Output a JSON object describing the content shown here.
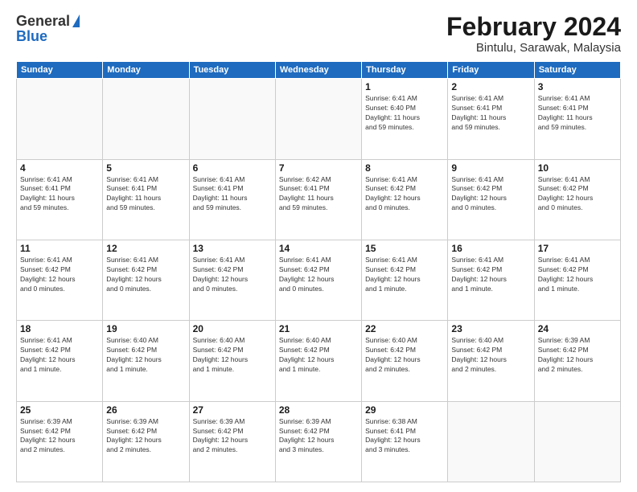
{
  "logo": {
    "general": "General",
    "blue": "Blue"
  },
  "title": {
    "month_year": "February 2024",
    "location": "Bintulu, Sarawak, Malaysia"
  },
  "weekdays": [
    "Sunday",
    "Monday",
    "Tuesday",
    "Wednesday",
    "Thursday",
    "Friday",
    "Saturday"
  ],
  "weeks": [
    [
      {
        "day": "",
        "info": ""
      },
      {
        "day": "",
        "info": ""
      },
      {
        "day": "",
        "info": ""
      },
      {
        "day": "",
        "info": ""
      },
      {
        "day": "1",
        "info": "Sunrise: 6:41 AM\nSunset: 6:40 PM\nDaylight: 11 hours\nand 59 minutes."
      },
      {
        "day": "2",
        "info": "Sunrise: 6:41 AM\nSunset: 6:41 PM\nDaylight: 11 hours\nand 59 minutes."
      },
      {
        "day": "3",
        "info": "Sunrise: 6:41 AM\nSunset: 6:41 PM\nDaylight: 11 hours\nand 59 minutes."
      }
    ],
    [
      {
        "day": "4",
        "info": "Sunrise: 6:41 AM\nSunset: 6:41 PM\nDaylight: 11 hours\nand 59 minutes."
      },
      {
        "day": "5",
        "info": "Sunrise: 6:41 AM\nSunset: 6:41 PM\nDaylight: 11 hours\nand 59 minutes."
      },
      {
        "day": "6",
        "info": "Sunrise: 6:41 AM\nSunset: 6:41 PM\nDaylight: 11 hours\nand 59 minutes."
      },
      {
        "day": "7",
        "info": "Sunrise: 6:42 AM\nSunset: 6:41 PM\nDaylight: 11 hours\nand 59 minutes."
      },
      {
        "day": "8",
        "info": "Sunrise: 6:41 AM\nSunset: 6:42 PM\nDaylight: 12 hours\nand 0 minutes."
      },
      {
        "day": "9",
        "info": "Sunrise: 6:41 AM\nSunset: 6:42 PM\nDaylight: 12 hours\nand 0 minutes."
      },
      {
        "day": "10",
        "info": "Sunrise: 6:41 AM\nSunset: 6:42 PM\nDaylight: 12 hours\nand 0 minutes."
      }
    ],
    [
      {
        "day": "11",
        "info": "Sunrise: 6:41 AM\nSunset: 6:42 PM\nDaylight: 12 hours\nand 0 minutes."
      },
      {
        "day": "12",
        "info": "Sunrise: 6:41 AM\nSunset: 6:42 PM\nDaylight: 12 hours\nand 0 minutes."
      },
      {
        "day": "13",
        "info": "Sunrise: 6:41 AM\nSunset: 6:42 PM\nDaylight: 12 hours\nand 0 minutes."
      },
      {
        "day": "14",
        "info": "Sunrise: 6:41 AM\nSunset: 6:42 PM\nDaylight: 12 hours\nand 0 minutes."
      },
      {
        "day": "15",
        "info": "Sunrise: 6:41 AM\nSunset: 6:42 PM\nDaylight: 12 hours\nand 1 minute."
      },
      {
        "day": "16",
        "info": "Sunrise: 6:41 AM\nSunset: 6:42 PM\nDaylight: 12 hours\nand 1 minute."
      },
      {
        "day": "17",
        "info": "Sunrise: 6:41 AM\nSunset: 6:42 PM\nDaylight: 12 hours\nand 1 minute."
      }
    ],
    [
      {
        "day": "18",
        "info": "Sunrise: 6:41 AM\nSunset: 6:42 PM\nDaylight: 12 hours\nand 1 minute."
      },
      {
        "day": "19",
        "info": "Sunrise: 6:40 AM\nSunset: 6:42 PM\nDaylight: 12 hours\nand 1 minute."
      },
      {
        "day": "20",
        "info": "Sunrise: 6:40 AM\nSunset: 6:42 PM\nDaylight: 12 hours\nand 1 minute."
      },
      {
        "day": "21",
        "info": "Sunrise: 6:40 AM\nSunset: 6:42 PM\nDaylight: 12 hours\nand 1 minute."
      },
      {
        "day": "22",
        "info": "Sunrise: 6:40 AM\nSunset: 6:42 PM\nDaylight: 12 hours\nand 2 minutes."
      },
      {
        "day": "23",
        "info": "Sunrise: 6:40 AM\nSunset: 6:42 PM\nDaylight: 12 hours\nand 2 minutes."
      },
      {
        "day": "24",
        "info": "Sunrise: 6:39 AM\nSunset: 6:42 PM\nDaylight: 12 hours\nand 2 minutes."
      }
    ],
    [
      {
        "day": "25",
        "info": "Sunrise: 6:39 AM\nSunset: 6:42 PM\nDaylight: 12 hours\nand 2 minutes."
      },
      {
        "day": "26",
        "info": "Sunrise: 6:39 AM\nSunset: 6:42 PM\nDaylight: 12 hours\nand 2 minutes."
      },
      {
        "day": "27",
        "info": "Sunrise: 6:39 AM\nSunset: 6:42 PM\nDaylight: 12 hours\nand 2 minutes."
      },
      {
        "day": "28",
        "info": "Sunrise: 6:39 AM\nSunset: 6:42 PM\nDaylight: 12 hours\nand 3 minutes."
      },
      {
        "day": "29",
        "info": "Sunrise: 6:38 AM\nSunset: 6:41 PM\nDaylight: 12 hours\nand 3 minutes."
      },
      {
        "day": "",
        "info": ""
      },
      {
        "day": "",
        "info": ""
      }
    ]
  ]
}
